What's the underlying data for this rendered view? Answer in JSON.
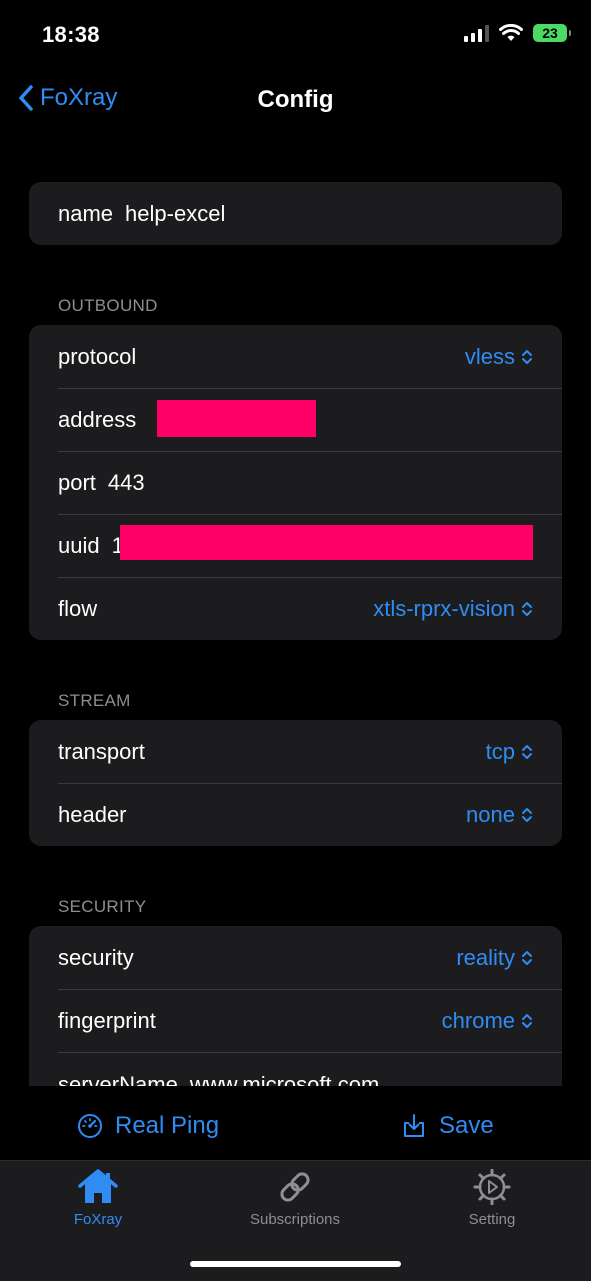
{
  "status": {
    "time": "18:38",
    "battery": "23"
  },
  "nav": {
    "back_label": "FoXray",
    "title": "Config"
  },
  "name_row": {
    "label": "name",
    "value": "help-excel"
  },
  "outbound": {
    "header": "OUTBOUND",
    "protocol": {
      "label": "protocol",
      "value": "vless"
    },
    "address": {
      "label": "address"
    },
    "port": {
      "label": "port",
      "value": "443"
    },
    "uuid": {
      "label": "uuid",
      "value": "1"
    },
    "flow": {
      "label": "flow",
      "value": "xtls-rprx-vision"
    }
  },
  "stream": {
    "header": "STREAM",
    "transport": {
      "label": "transport",
      "value": "tcp"
    },
    "header_row": {
      "label": "header",
      "value": "none"
    }
  },
  "security": {
    "header": "SECURITY",
    "security": {
      "label": "security",
      "value": "reality"
    },
    "fingerprint": {
      "label": "fingerprint",
      "value": "chrome"
    },
    "server_name": {
      "label": "serverName",
      "value": "www.microsoft.com"
    }
  },
  "actions": {
    "real_ping": "Real Ping",
    "save": "Save"
  },
  "tabs": [
    {
      "label": "FoXray",
      "icon": "house-icon",
      "active": true
    },
    {
      "label": "Subscriptions",
      "icon": "link-icon",
      "active": false
    },
    {
      "label": "Setting",
      "icon": "gear-icon",
      "active": false
    }
  ],
  "colors": {
    "accent": "#2f8cf2",
    "redaction": "#ff0066",
    "group_bg": "#1c1c1e"
  }
}
